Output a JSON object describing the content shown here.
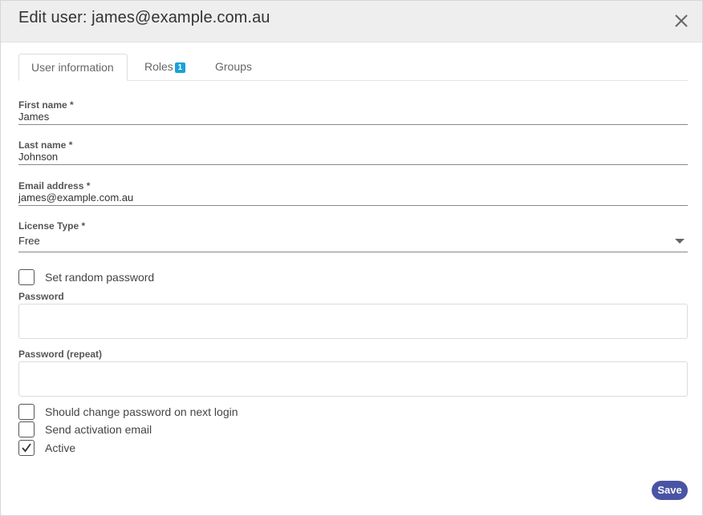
{
  "header": {
    "title": "Edit user: james@example.com.au",
    "close_icon": "close-icon"
  },
  "tabs": [
    {
      "label": "User information",
      "active": true
    },
    {
      "label": "Roles",
      "badge": "1",
      "active": false
    },
    {
      "label": "Groups",
      "active": false
    }
  ],
  "form": {
    "first_name": {
      "label": "First name *",
      "value": "James"
    },
    "last_name": {
      "label": "Last name *",
      "value": "Johnson"
    },
    "email": {
      "label": "Email address *",
      "value": "james@example.com.au"
    },
    "license_type": {
      "label": "License Type *",
      "value": "Free"
    },
    "set_random_password": {
      "label": "Set random password",
      "checked": false
    },
    "password": {
      "label": "Password",
      "value": ""
    },
    "password_repeat": {
      "label": "Password (repeat)",
      "value": ""
    },
    "should_change_password": {
      "label": "Should change password on next login",
      "checked": false
    },
    "send_activation_email": {
      "label": "Send activation email",
      "checked": false
    },
    "active": {
      "label": "Active",
      "checked": true
    }
  },
  "footer": {
    "save_label": "Save"
  },
  "colors": {
    "header_bg": "#eeeeee",
    "badge": "#17a2d8",
    "save_button": "#4a54a4"
  }
}
